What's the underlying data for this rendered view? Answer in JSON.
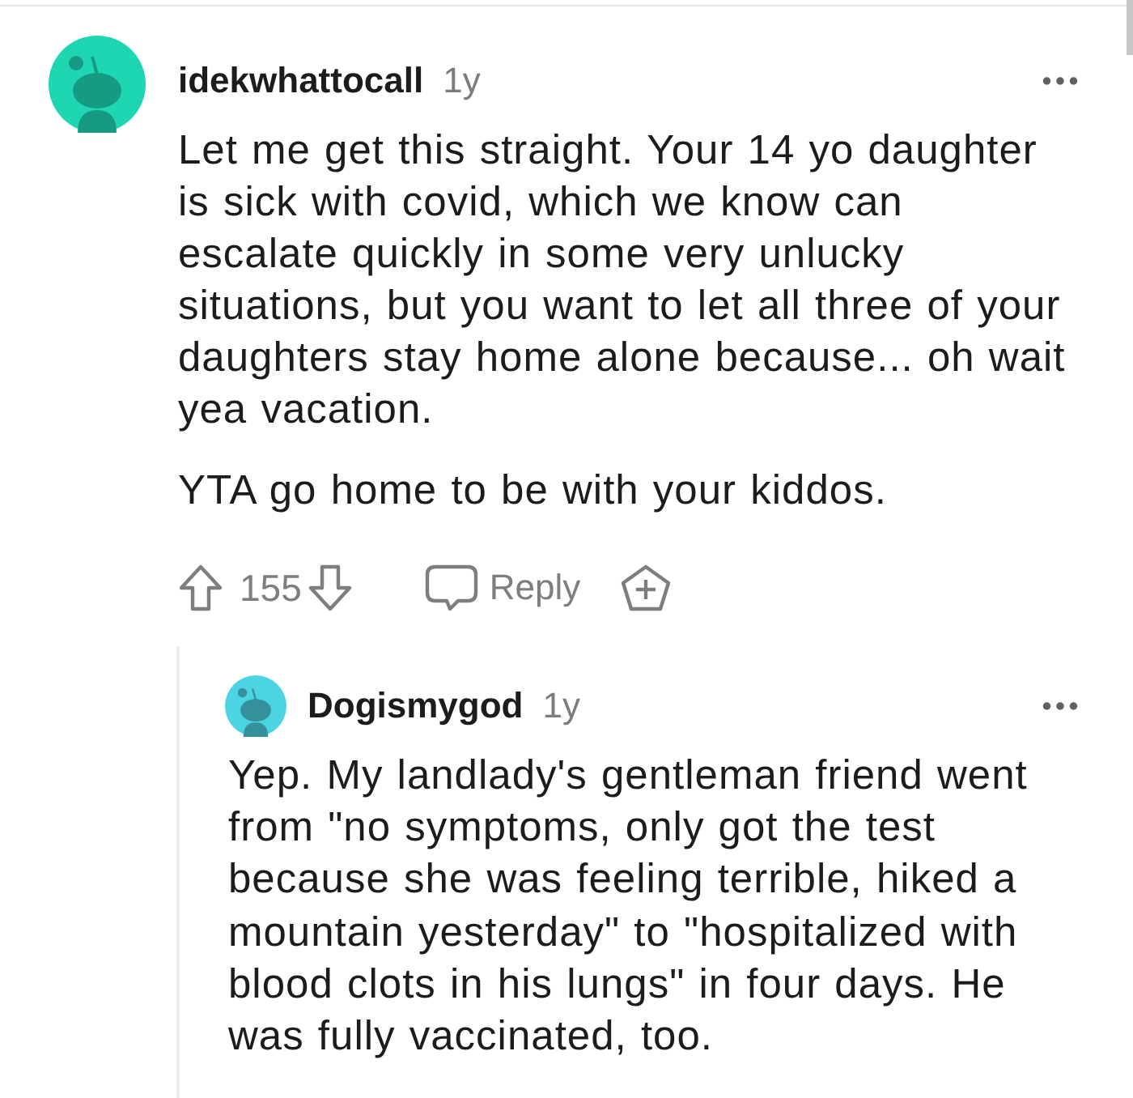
{
  "comment": {
    "author": "idekwhattocall",
    "age": "1y",
    "color": "#1fd6b3",
    "paragraphs": [
      "Let me get this straight. Your 14 yo daughter is sick with covid, which we know can escalate quickly in some very unlucky situations, but you want to let all three of your daughters stay home alone because... oh wait yea vacation.",
      "YTA go home to be with your kiddos."
    ],
    "votes": "155",
    "reply_label": "Reply",
    "replies": [
      {
        "author": "Dogismygod",
        "age": "1y",
        "color": "#4dd4e3",
        "paragraphs": [
          "Yep. My landlady's gentleman friend went from \"no symptoms, only got the test because she was feeling terrible, hiked a mountain yesterday\" to \"hospitalized with blood clots in his lungs\" in four days. He was fully vaccinated, too."
        ]
      }
    ]
  }
}
